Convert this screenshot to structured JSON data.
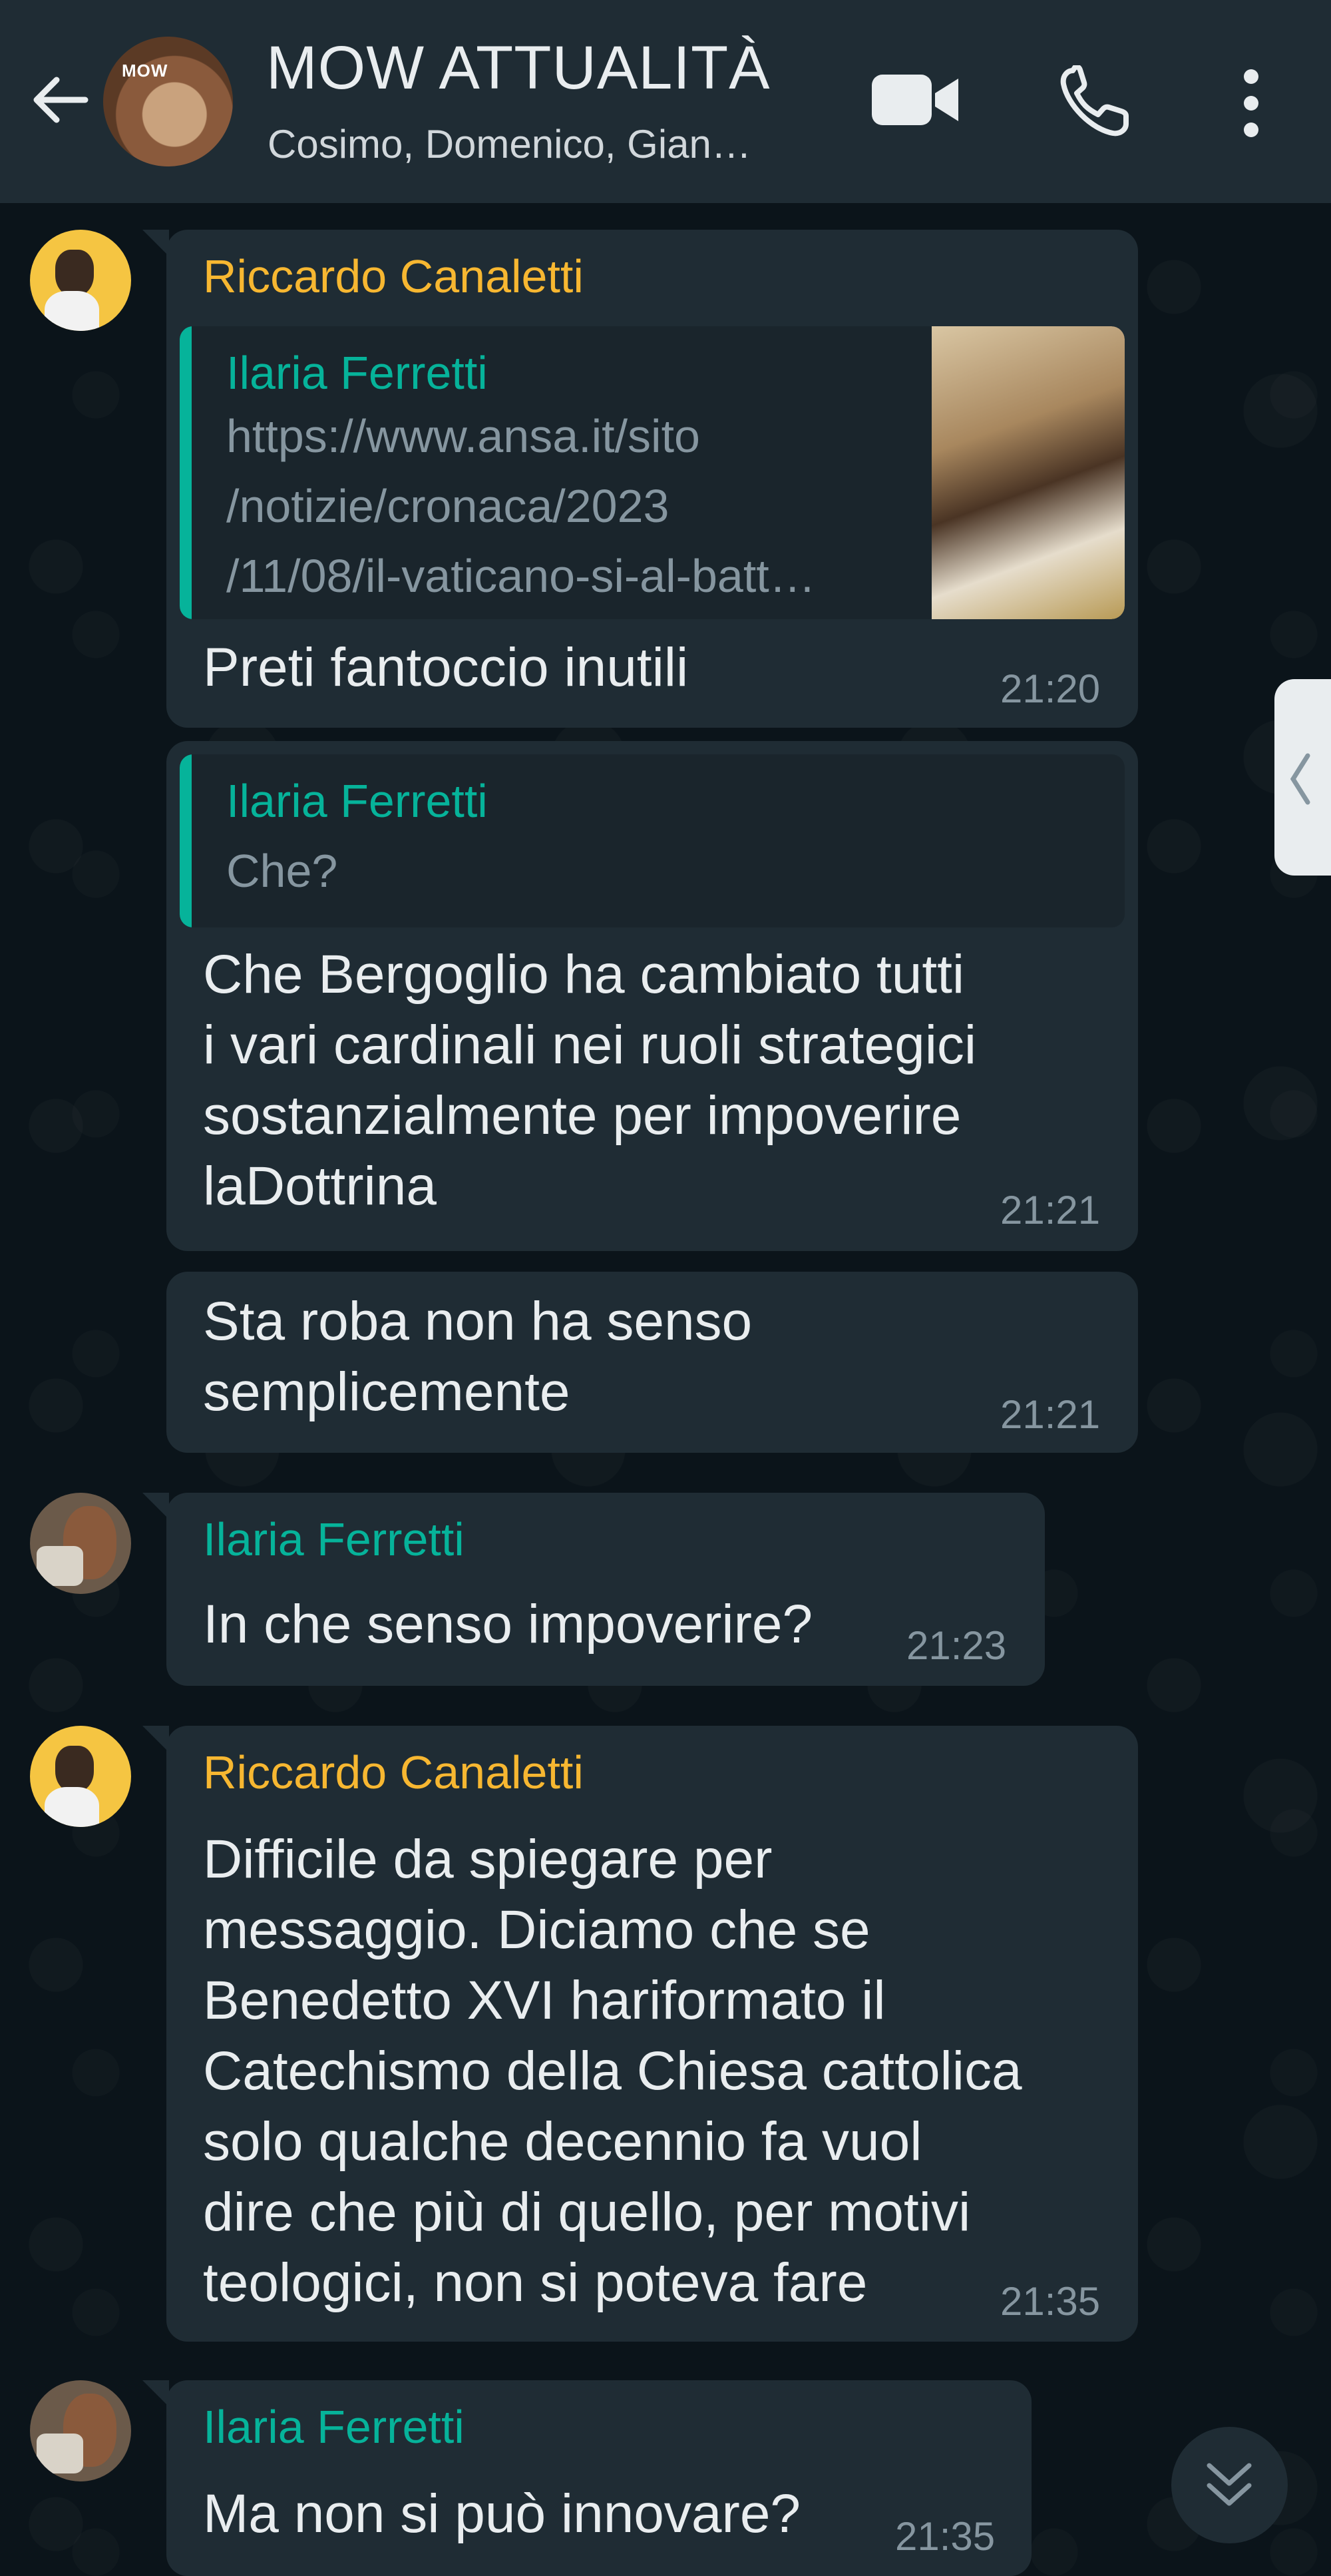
{
  "header": {
    "title": "MOW ATTUALITÀ",
    "subtitle": "Cosimo, Domenico, Gian…",
    "avatar_mark": "MOW",
    "icons": [
      "back-arrow-icon",
      "video-call-icon",
      "phone-icon",
      "more-vert-icon"
    ]
  },
  "colors": {
    "background": "#0b141a",
    "header": "#1f2c34",
    "bubble": "#1f2c34",
    "name_orange": "#f7b731",
    "name_teal": "#06b39a",
    "time": "#8696a0"
  },
  "messages": [
    {
      "sender": "Riccardo Canaletti",
      "quote": {
        "name": "Ilaria Ferretti",
        "lines": [
          "https://www.ansa.it/sito",
          "/notizie/cronaca/2023",
          "/11/08/il-vaticano-si-al-batt…"
        ]
      },
      "lines": [
        "Preti fantoccio inutili"
      ],
      "time": "21:20"
    },
    {
      "quote": {
        "name": "Ilaria Ferretti",
        "lines": [
          "Che?"
        ]
      },
      "lines": [
        "Che Bergoglio ha cambiato tutti",
        "i vari cardinali nei ruoli strategici",
        "sostanzialmente per impoverire",
        "laDottrina"
      ],
      "time": "21:21"
    },
    {
      "lines": [
        "Sta roba non ha senso",
        "semplicemente"
      ],
      "time": "21:21"
    },
    {
      "sender": "Ilaria Ferretti",
      "lines": [
        "In che senso impoverire?"
      ],
      "time": "21:23"
    },
    {
      "sender": "Riccardo Canaletti",
      "lines": [
        "Difficile da spiegare per",
        "messaggio. Diciamo che se",
        "Benedetto XVI hariformato il",
        "Catechismo della Chiesa cattolica",
        "solo qualche decennio fa vuol",
        "dire che più di quello, per motivi",
        "teologici, non si poteva fare"
      ],
      "time": "21:35"
    },
    {
      "sender": "Ilaria Ferretti",
      "lines": [
        "Ma non si può innovare?"
      ],
      "time": "21:35"
    }
  ]
}
